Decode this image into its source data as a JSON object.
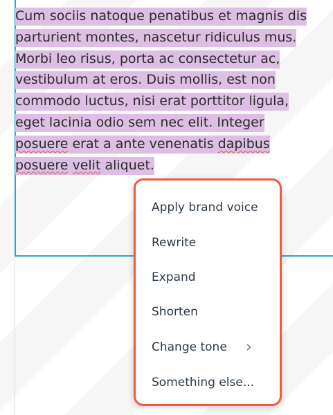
{
  "editor": {
    "lines": [
      "Cum sociis natoque penatibus et magnis dis",
      "parturient montes, nascetur ridiculus mus.",
      "Morbi leo risus, porta ac consectetur ac,",
      "vestibulum at eros. Duis mollis, est non",
      "commodo luctus, nisi erat porttitor ligula,",
      "eget lacinia odio sem nec elit. Integer"
    ],
    "line7_a": "posuere",
    "line7_b": " erat a ante venenatis ",
    "line7_c": "dapibus",
    "line8_a": "posuere",
    "line8_b": " ",
    "line8_c": "velit",
    "line8_d": " aliquet.",
    "selection_color": "#dcbfe2",
    "border_color": "#26a8c7"
  },
  "context_menu": {
    "border_color": "#ef5b3c",
    "items": [
      {
        "label": "Apply brand voice"
      },
      {
        "label": "Rewrite"
      },
      {
        "label": "Expand"
      },
      {
        "label": "Shorten"
      },
      {
        "label": "Change tone",
        "icon": "chevron-right-icon"
      },
      {
        "label": "Something else..."
      }
    ]
  }
}
